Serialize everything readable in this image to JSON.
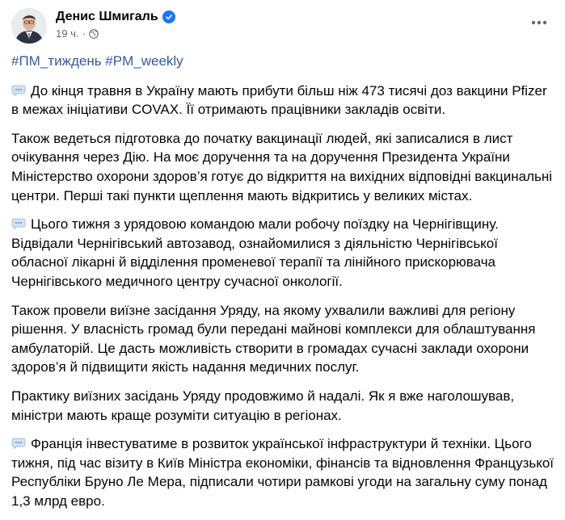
{
  "post": {
    "author": "Денис Шмигаль",
    "time": "19 ч.",
    "separator": "·",
    "hashtags": [
      "#ПМ_тиждень",
      "#PM_weekly"
    ],
    "paragraphs": [
      {
        "emoji": true,
        "text": "До кінця травня в Україну мають прибути більш ніж 473 тисячі доз вакцини Pfizer в межах ініціативи COVAX. Її отримають працівники закладів освіти."
      },
      {
        "emoji": false,
        "text": "Також ведеться підготовка до початку вакцинації людей, які записалися в лист очікування через Дію. На моє доручення та на доручення Президента України Міністерство охорони здоров’я готує до відкриття на вихідних відповідні вакцинальні центри. Перші такі пункти щеплення мають відкритись у великих містах."
      },
      {
        "emoji": true,
        "text": "Цього тижня з урядовою командою мали робочу поїздку на Чернігівщину. Відвідали Чернігівський автозавод, ознайомилися з діяльністю Чернігівської обласної лікарні й відділення променевої терапії та лінійного прискорювача Чернігівського медичного центру сучасної онкології."
      },
      {
        "emoji": false,
        "text": "Також провели виїзне засідання Уряду, на якому ухвалили важливі для регіону рішення. У власність громад були передані майнові комплекси для облаштування амбулаторій. Це дасть можливість створити в громадах сучасні заклади охорони здоров’я й підвищити якість надання медичних послуг."
      },
      {
        "emoji": false,
        "text": "Практику виїзних засідань Уряду продовжимо й надалі. Як я вже наголошував, міністри мають краще розуміти ситуацію в регіонах."
      },
      {
        "emoji": true,
        "text": "Франція інвестуватиме в розвиток української інфраструктури й техніки. Цього тижня, під час візиту в Київ Міністра економіки, фінансів та відновлення Французької Республіки Бруно Ле Мера, підписали чотири рамкові угоди на загальну суму понад 1,3 млрд евро."
      }
    ]
  },
  "icons": {
    "verified": "verified-badge-icon",
    "audience": "globe-icon",
    "more": "more-horizontal-icon",
    "speech": "speech-bubble-emoji"
  },
  "colors": {
    "link": "#385898",
    "verified": "#1877f2",
    "meta": "#65676b",
    "text": "#050505"
  }
}
